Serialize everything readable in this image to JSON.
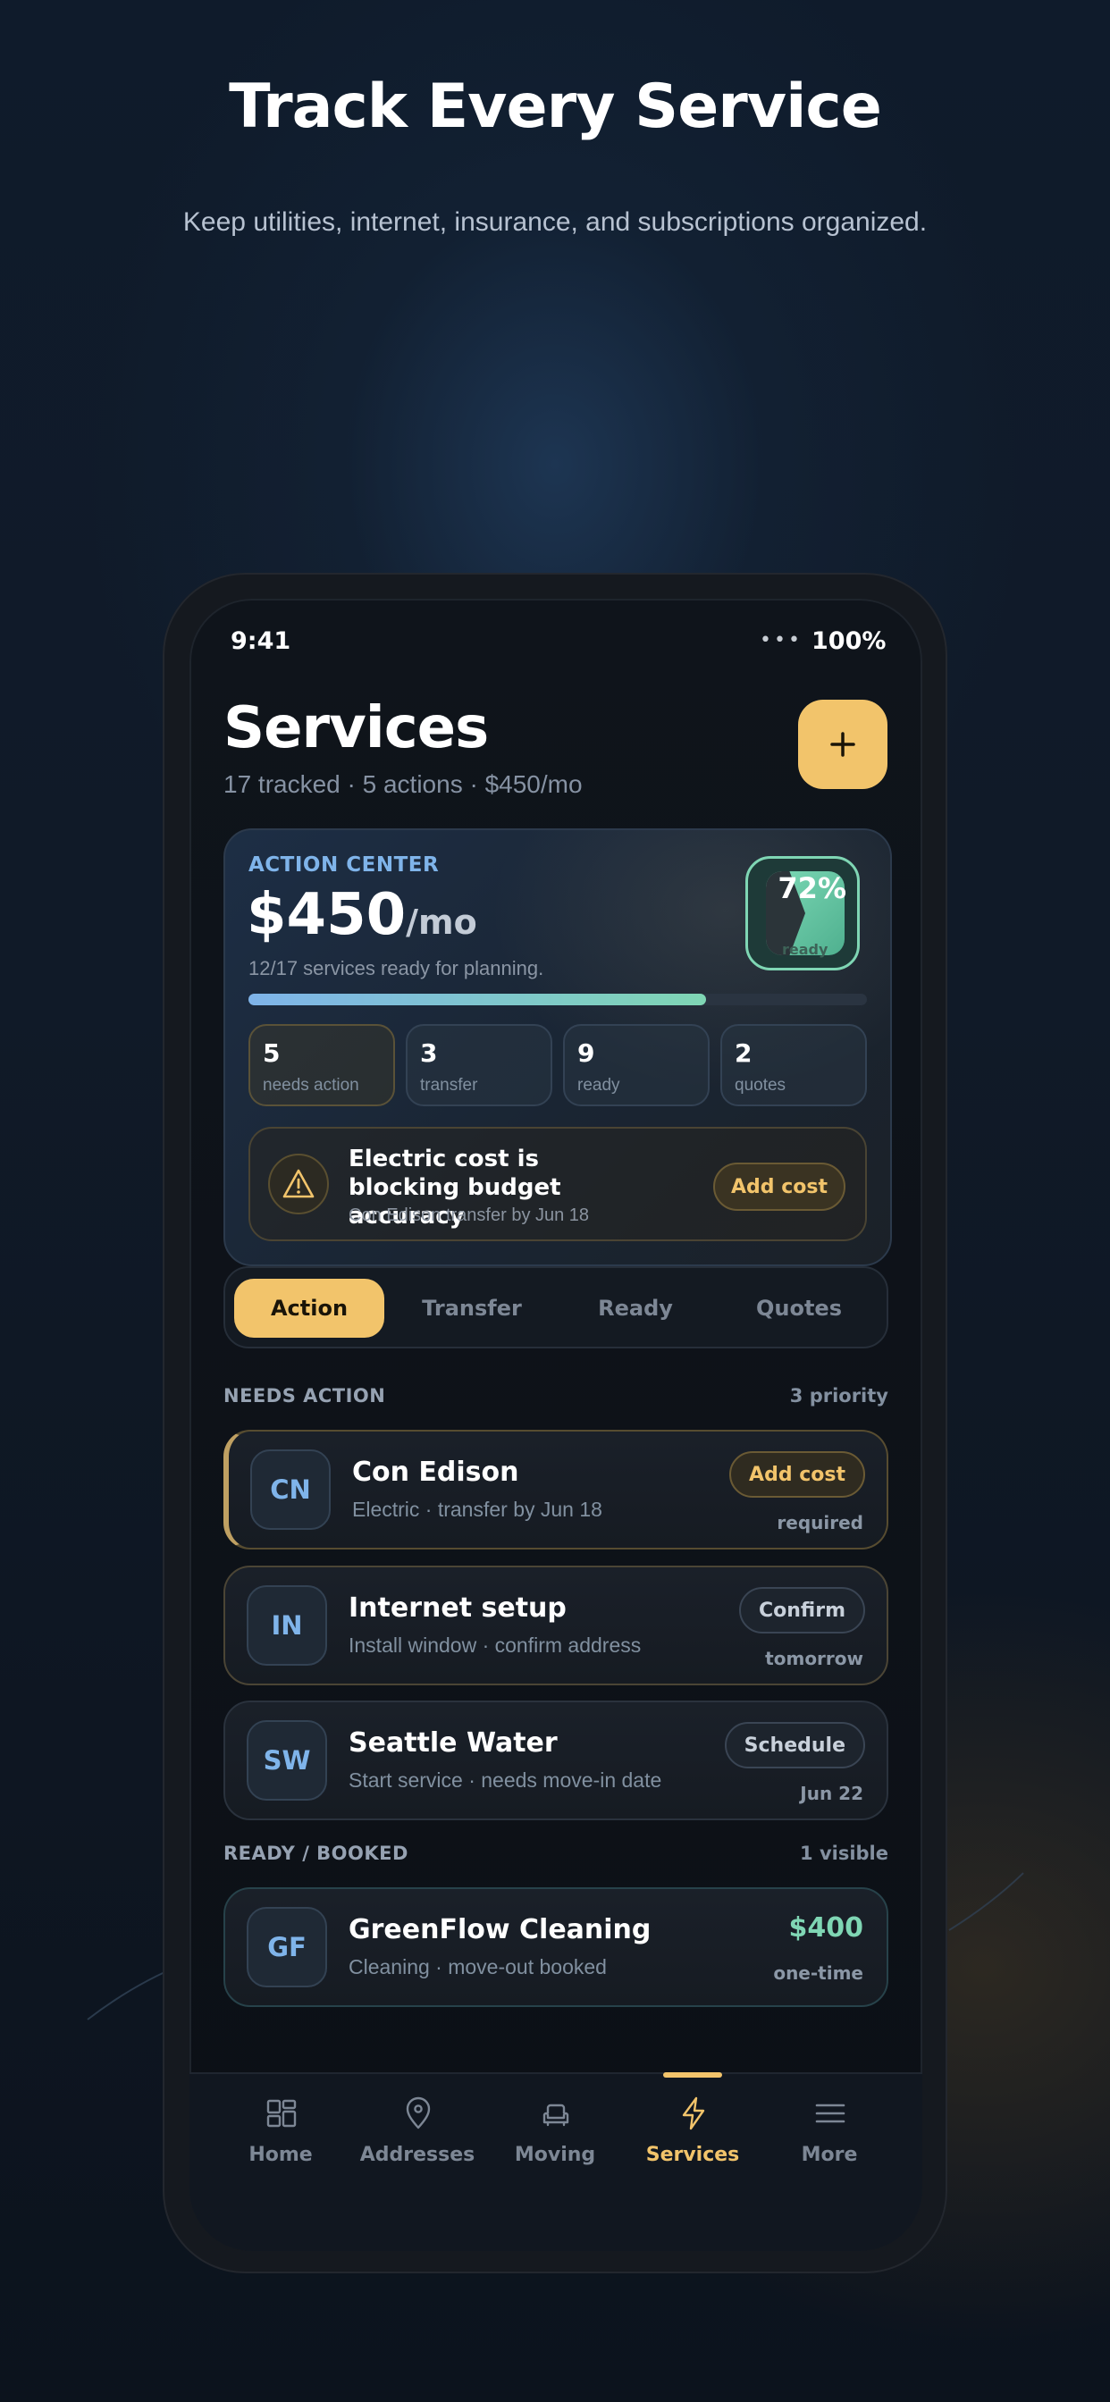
{
  "hero": {
    "title": "Track Every Service",
    "subtitle": "Keep utilities, internet, insurance, and subscriptions organized."
  },
  "status_bar": {
    "time": "9:41",
    "signal": "•••",
    "battery": "100%"
  },
  "header": {
    "title": "Services",
    "subtitle": "17 tracked · 5 actions · $450/mo",
    "add_icon": "plus-icon"
  },
  "action_center": {
    "label": "ACTION CENTER",
    "amount": "$450",
    "amount_unit": "/mo",
    "description": "12/17 services ready for planning.",
    "ready_percent_label": "72%",
    "ready_label": "ready",
    "progress": 0.74,
    "stats": [
      {
        "value": "5",
        "label": "needs action"
      },
      {
        "value": "3",
        "label": "transfer"
      },
      {
        "value": "9",
        "label": "ready"
      },
      {
        "value": "2",
        "label": "quotes"
      }
    ],
    "alert": {
      "icon": "warning-icon",
      "title": "Electric cost is blocking budget accuracy",
      "subtitle": "Con Edison transfer by Jun 18",
      "button": "Add cost"
    }
  },
  "tabs": [
    "Action",
    "Transfer",
    "Ready",
    "Quotes"
  ],
  "active_tab": "Action",
  "needs_action": {
    "heading": "NEEDS ACTION",
    "count": "3 priority",
    "items": [
      {
        "initials": "CN",
        "name": "Con Edison",
        "meta": "Electric · transfer by Jun 18",
        "button": "Add cost",
        "note": "required"
      },
      {
        "initials": "IN",
        "name": "Internet setup",
        "meta": "Install window · confirm address",
        "button": "Confirm",
        "note": "tomorrow"
      },
      {
        "initials": "SW",
        "name": "Seattle Water",
        "meta": "Start service · needs move-in date",
        "button": "Schedule",
        "note": "Jun 22"
      }
    ]
  },
  "ready_booked": {
    "heading": "READY / BOOKED",
    "count": "1 visible",
    "items": [
      {
        "initials": "GF",
        "name": "GreenFlow Cleaning",
        "meta": "Cleaning · move-out booked",
        "price": "$400",
        "note": "one-time"
      }
    ]
  },
  "nav": {
    "items": [
      {
        "label": "Home",
        "icon": "grid-icon"
      },
      {
        "label": "Addresses",
        "icon": "map-pin-icon"
      },
      {
        "label": "Moving",
        "icon": "couch-icon"
      },
      {
        "label": "Services",
        "icon": "lightning-icon"
      },
      {
        "label": "More",
        "icon": "menu-icon"
      }
    ],
    "active": "Services"
  },
  "colors": {
    "accent_gold": "#f2c46b",
    "accent_blue": "#7fb4ea",
    "accent_teal": "#7fd6b4",
    "background": "#0f1b2b"
  }
}
